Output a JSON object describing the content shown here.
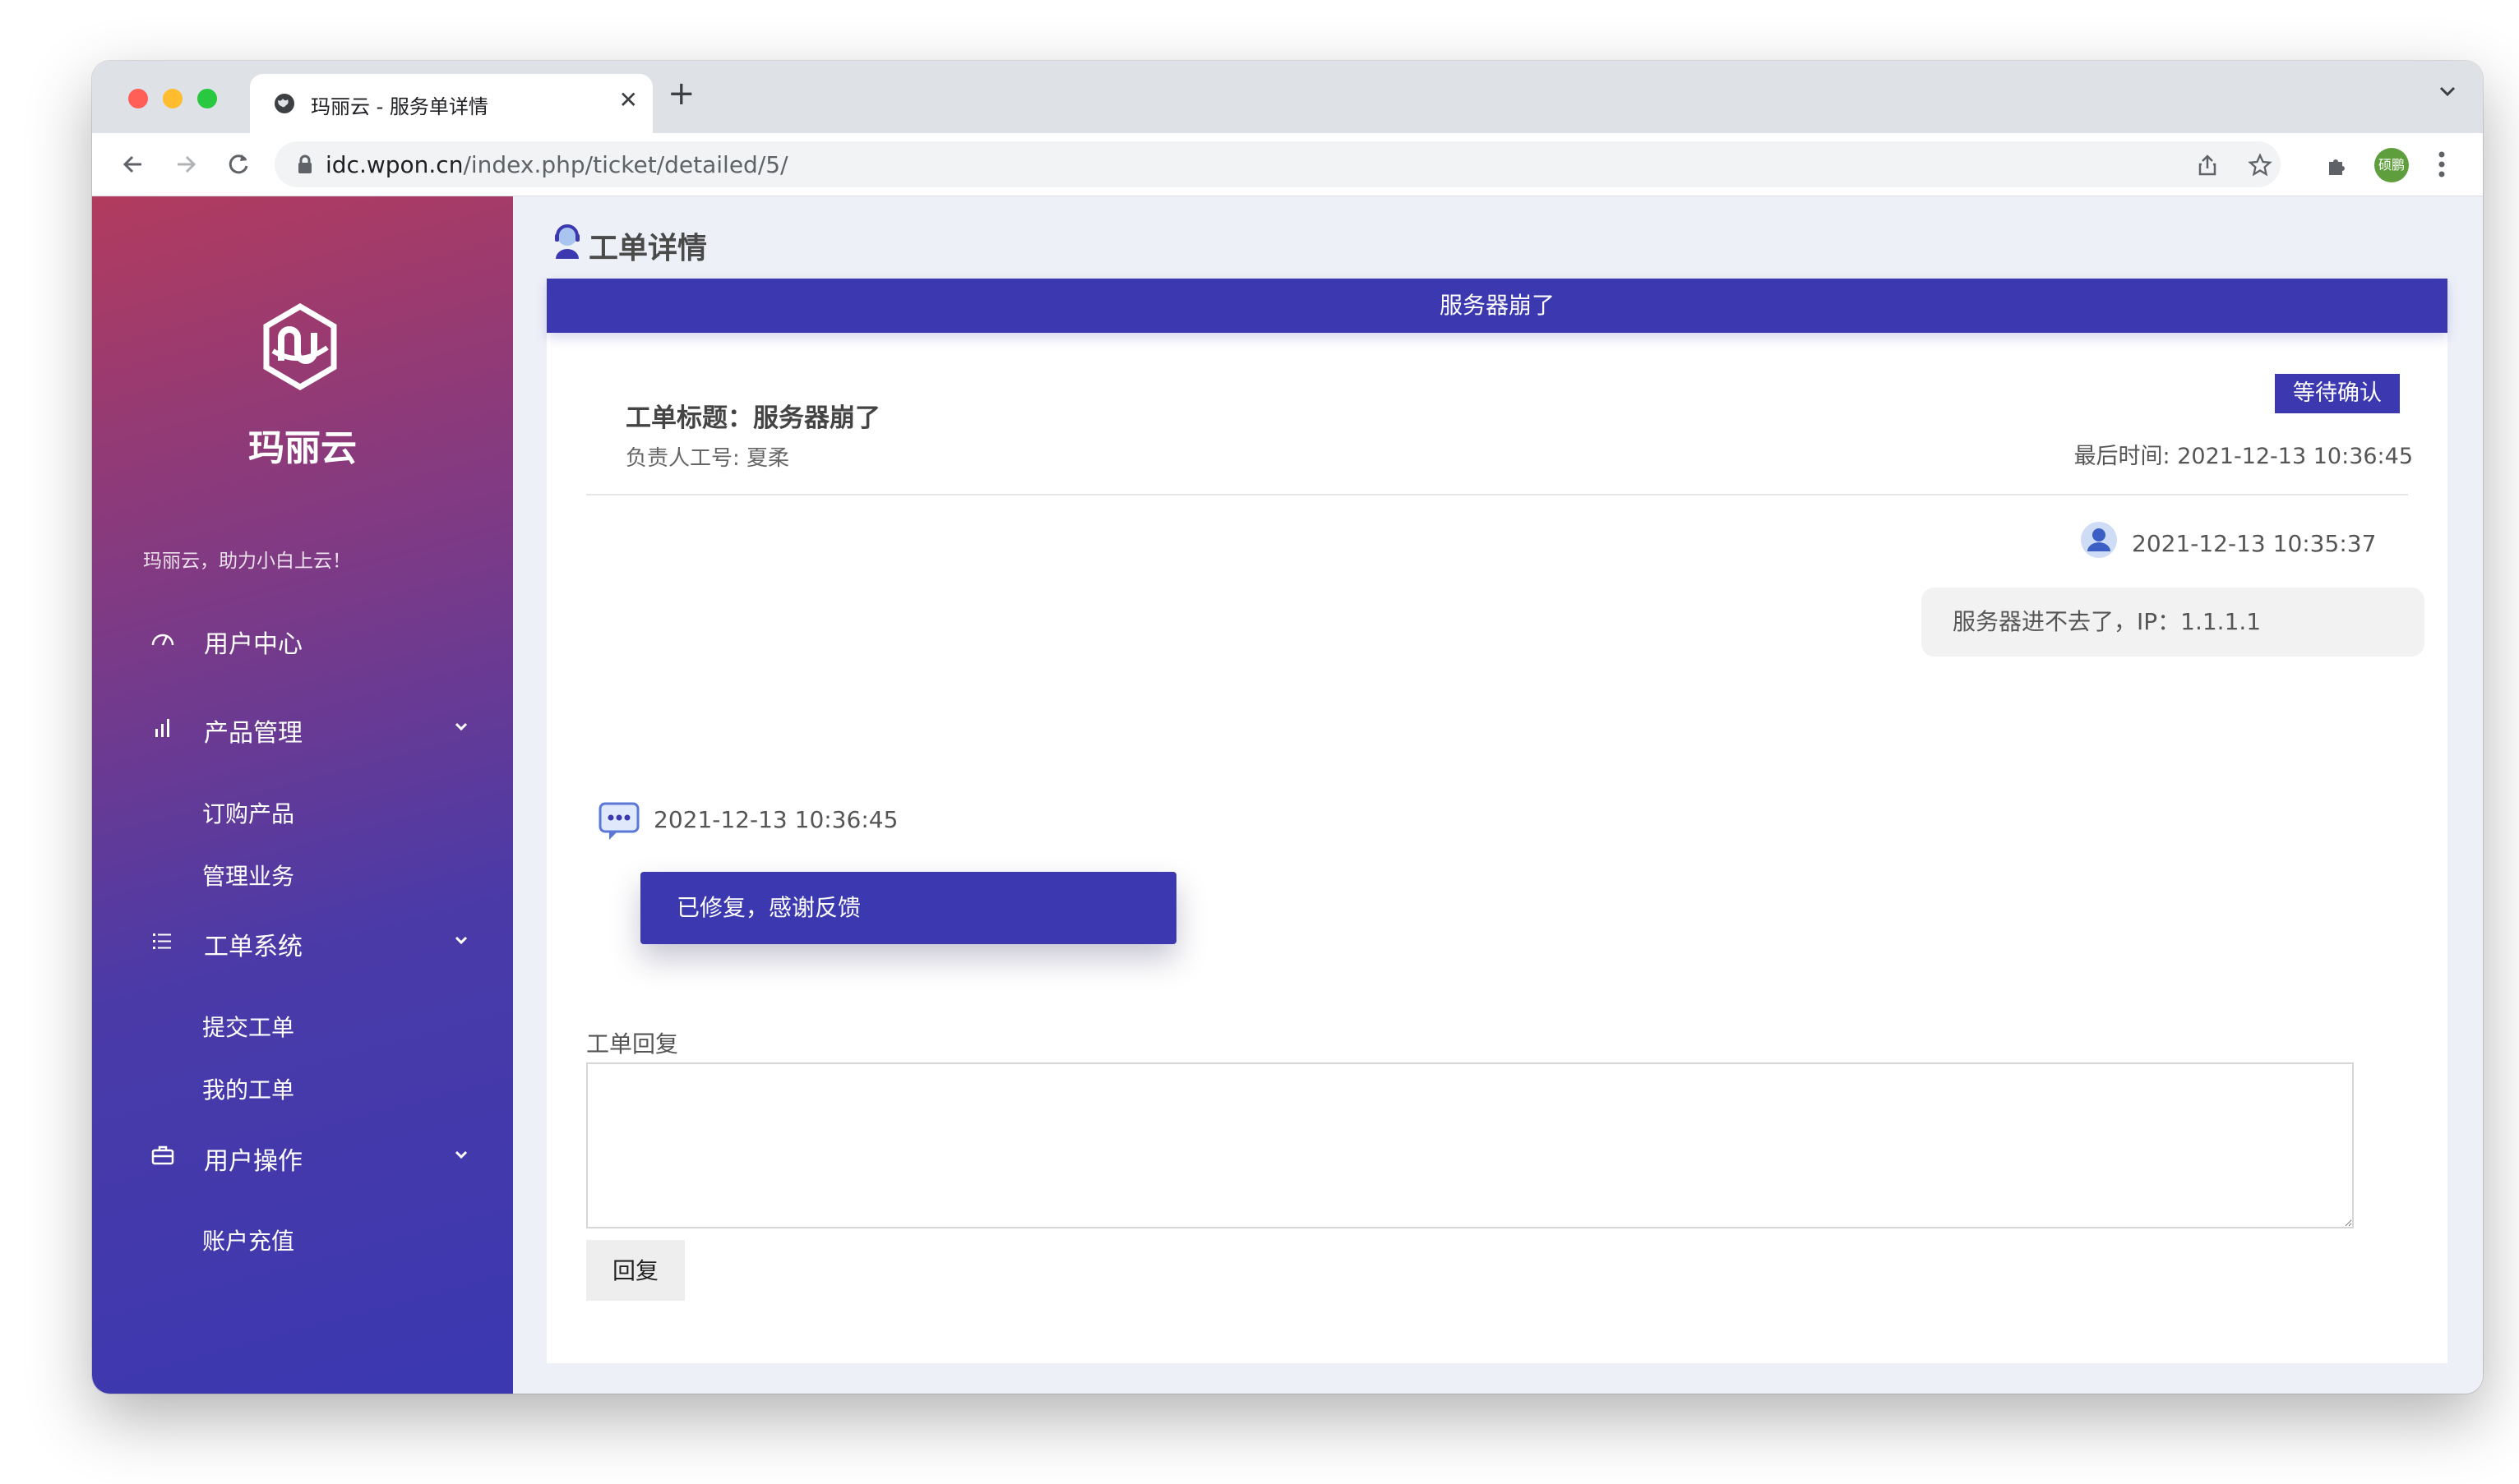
{
  "browser": {
    "tab_title": "玛丽云 - 服务单详情",
    "close_glyph": "✕",
    "newtab_glyph": "+",
    "url_host": "idc.wpon.cn",
    "url_path": "/index.php/ticket/detailed/5/",
    "profile_initials": "硕鹏"
  },
  "sidebar": {
    "brand": "玛丽云",
    "slogan": "玛丽云，助力小白上云！",
    "items": [
      {
        "label": "用户中心",
        "icon": "dashboard-icon",
        "expandable": false
      },
      {
        "label": "产品管理",
        "icon": "bar-chart-icon",
        "expandable": true,
        "children": [
          "订购产品",
          "管理业务"
        ]
      },
      {
        "label": "工单系统",
        "icon": "list-icon",
        "expandable": true,
        "children": [
          "提交工单",
          "我的工单"
        ]
      },
      {
        "label": "用户操作",
        "icon": "briefcase-icon",
        "expandable": true,
        "children": [
          "账户充值"
        ]
      }
    ]
  },
  "page": {
    "heading": "工单详情",
    "card_header": "服务器崩了",
    "status_badge": "等待确认",
    "ticket_title": "工单标题：服务器崩了",
    "assignee": "负责人工号: 夏柔",
    "last_time": "最后时间: 2021-12-13 10:36:45"
  },
  "messages": [
    {
      "from": "user",
      "time": "2021-12-13 10:35:37",
      "text": "服务器进不去了，IP：1.1.1.1"
    },
    {
      "from": "staff",
      "time": "2021-12-13 10:36:45",
      "text": "已修复，感谢反馈"
    }
  ],
  "reply": {
    "label": "工单回复",
    "value": "",
    "button": "回复"
  },
  "colors": {
    "primary": "#3b38b0",
    "sidebar_top": "#b23b5e",
    "sidebar_bottom": "#3b38b0",
    "bubble_user": "#f2f2f2"
  }
}
